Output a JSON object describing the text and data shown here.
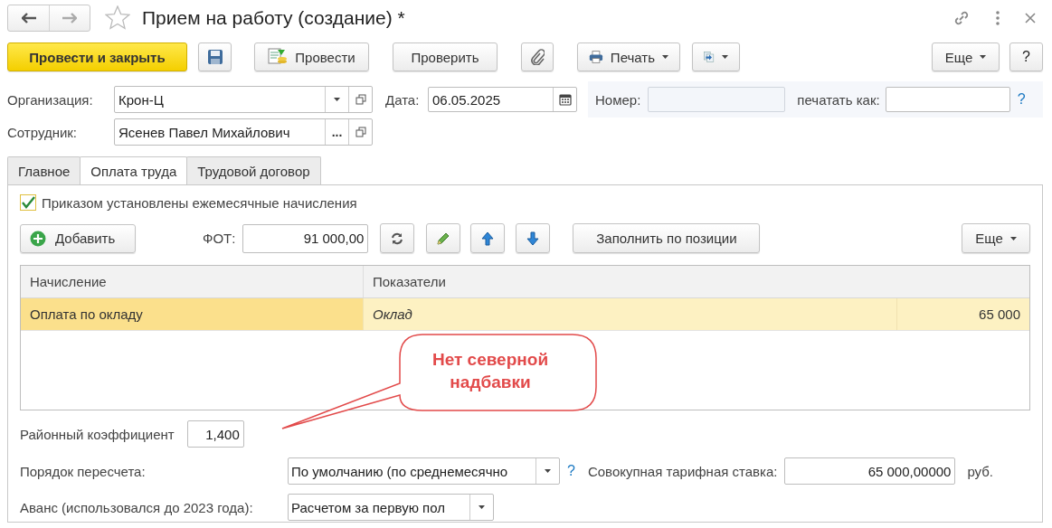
{
  "window": {
    "title": "Прием на работу (создание) *",
    "favorite": false
  },
  "toolbar": [
    {
      "kind": "primary",
      "label": "Провести и закрыть"
    },
    {
      "kind": "save"
    },
    {
      "kind": "post",
      "label": "Провести"
    },
    {
      "kind": "text",
      "label": "Проверить"
    },
    {
      "kind": "attach"
    },
    {
      "kind": "print",
      "label": "Печать"
    },
    {
      "kind": "export"
    },
    {
      "kind": "more",
      "label": "Еще"
    },
    {
      "kind": "help",
      "label": "?"
    }
  ],
  "organization": {
    "label": "Организация:",
    "value": "Крон-Ц"
  },
  "date": {
    "label": "Дата:",
    "value": "06.05.2025"
  },
  "number": {
    "label": "Номер:"
  },
  "print_as": {
    "label": "печатать как:",
    "help": "?"
  },
  "employee": {
    "label": "Сотрудник:",
    "value": "Ясенев Павел Михайлович",
    "select": "..."
  },
  "tabs": [
    {
      "label": "Главное",
      "selected": false
    },
    {
      "label": "Оплата труда",
      "selected": true
    },
    {
      "label": "Трудовой договор",
      "selected": false
    }
  ],
  "monthly_accruals": {
    "label": "Приказом установлены ежемесячные начисления",
    "checked": true
  },
  "table_toolbar": {
    "add": "Добавить",
    "fot_label": "ФОТ:",
    "fot_value": "91 000,00",
    "fill": "Заполнить по позиции",
    "more": "Еще"
  },
  "table": {
    "columns": [
      "Начисление",
      "Показатели"
    ],
    "rows": [
      {
        "cells": [
          "Оплата по окладу",
          "Оклад",
          "65 000"
        ],
        "selected": true
      }
    ]
  },
  "callout": {
    "text": "Нет северной надбавки"
  },
  "district_coefficient": {
    "label": "Районный коэффициент",
    "value": "1,400"
  },
  "recalculation": {
    "label": "Порядок пересчета:",
    "value": "По умолчанию (по среднемесячно",
    "help": "?"
  },
  "tariff_rate": {
    "label": "Совокупная тарифная ставка:",
    "value": "65 000,00000",
    "unit": "руб."
  },
  "advance": {
    "label": "Аванс (использовался до 2023 года):",
    "value": "Расчетом за первую пол"
  }
}
